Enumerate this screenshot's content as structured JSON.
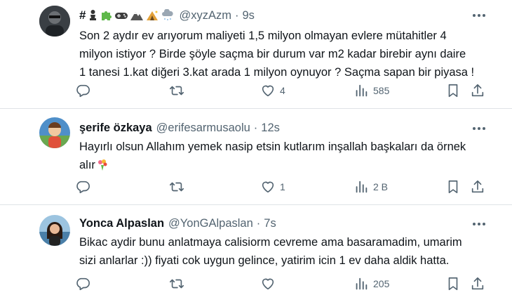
{
  "tweets": [
    {
      "display_name_emojis": [
        "hash",
        "chess-pawn",
        "puzzle",
        "gamepad",
        "mountain",
        "camping",
        "snow-cloud"
      ],
      "handle": "@xyzAzm",
      "dot": "·",
      "time": "9s",
      "text_lines": [
        "Son 2 aydır ev arıyorum maliyeti 1,5 milyon olmayan evlere mütahitler 4",
        "milyon istiyor ? Birde şöyle saçma bir durum var m2 kadar birebir aynı daire",
        "1 tanesi 1.kat diğeri 3.kat arada 1 milyon oynuyor ? Saçma sapan bir piyasa !"
      ],
      "replies": "",
      "retweets": "",
      "likes": "4",
      "views": "585"
    },
    {
      "name": "şerife özkaya",
      "handle": "@erifesarmusaolu",
      "dot": "·",
      "time": "12s",
      "text_lines": [
        "Hayırlı olsun Allahım yemek nasip etsin kutlarım inşallah başkaları da örnek",
        "alır"
      ],
      "replies": "",
      "retweets": "",
      "likes": "1",
      "views": "2 B"
    },
    {
      "name": "Yonca Alpaslan",
      "handle": "@YonGAlpaslan",
      "dot": "·",
      "time": "7s",
      "text_lines": [
        "Bikac aydir bunu anlatmaya calisiorm cevreme ama basaramadim, umarim",
        "sizi anlarlar :)) fiyati cok uygun gelince, yatirim icin 1 ev daha aldik hatta."
      ],
      "replies": "",
      "retweets": "",
      "likes": "",
      "views": "205"
    }
  ],
  "icons": {
    "reply": "reply-icon",
    "retweet": "retweet-icon",
    "like": "heart-icon",
    "views": "views-icon",
    "bookmark": "bookmark-icon",
    "share": "share-icon",
    "more": "more-icon",
    "bouquet": "bouquet-emoji"
  },
  "colors": {
    "text": "#0f1419",
    "muted": "#536471",
    "divider": "#dfe3e6"
  }
}
